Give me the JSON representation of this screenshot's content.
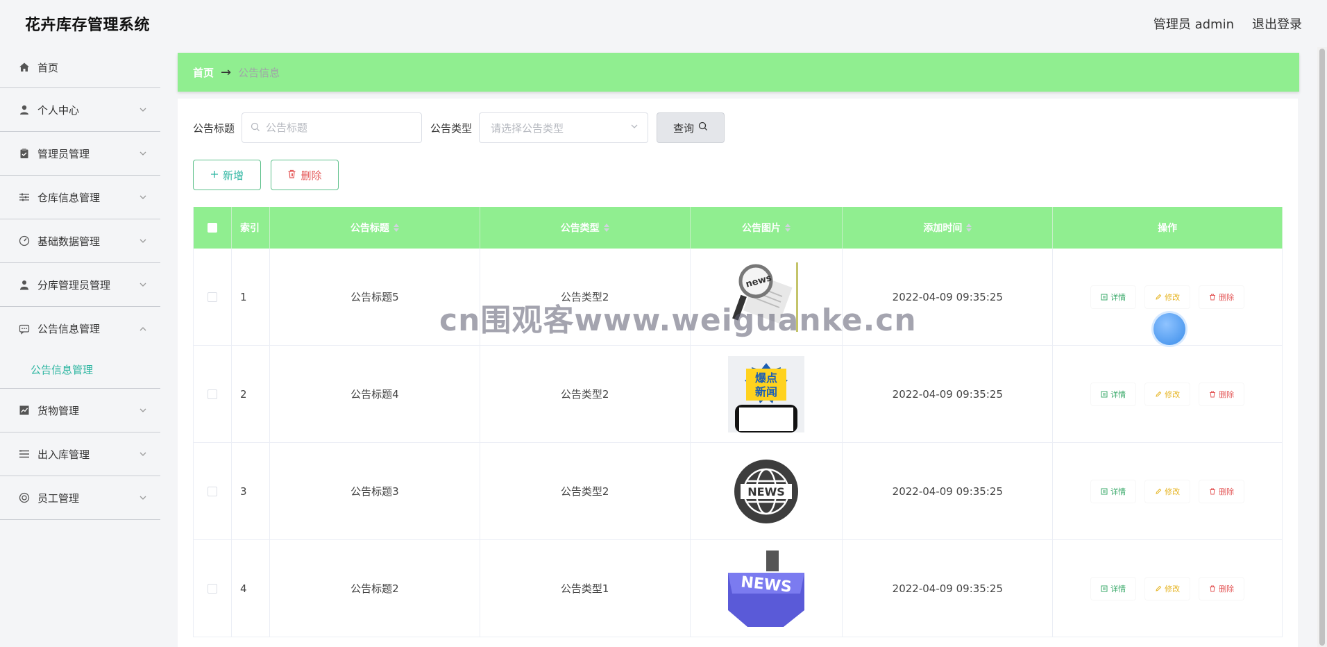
{
  "app": {
    "title": "花卉库存管理系统",
    "user_label": "管理员 admin",
    "logout_label": "退出登录"
  },
  "sidebar": {
    "items": [
      {
        "label": "首页",
        "icon": "home-icon"
      },
      {
        "label": "个人中心",
        "icon": "user-icon"
      },
      {
        "label": "管理员管理",
        "icon": "clipboard-icon"
      },
      {
        "label": "仓库信息管理",
        "icon": "sliders-icon"
      },
      {
        "label": "基础数据管理",
        "icon": "gauge-icon"
      },
      {
        "label": "分库管理员管理",
        "icon": "user-admin-icon"
      },
      {
        "label": "公告信息管理",
        "icon": "chat-icon",
        "open": true
      },
      {
        "label": "货物管理",
        "icon": "chart-icon"
      },
      {
        "label": "出入库管理",
        "icon": "list-icon"
      },
      {
        "label": "员工管理",
        "icon": "lifebuoy-icon"
      }
    ],
    "submenu_active": "公告信息管理"
  },
  "breadcrumb": {
    "home": "首页",
    "separator": "→",
    "current": "公告信息"
  },
  "search": {
    "title_label": "公告标题",
    "title_placeholder": "公告标题",
    "type_label": "公告类型",
    "type_placeholder": "请选择公告类型",
    "query_label": "查询"
  },
  "actions": {
    "add_label": "新增",
    "delete_label": "删除"
  },
  "table": {
    "headers": {
      "index": "索引",
      "title": "公告标题",
      "type": "公告类型",
      "image": "公告图片",
      "time": "添加时间",
      "ops": "操作"
    },
    "rows": [
      {
        "index": "1",
        "title": "公告标题5",
        "type": "公告类型2",
        "image": "news-magnifier",
        "time": "2022-04-09 09:35:25"
      },
      {
        "index": "2",
        "title": "公告标题4",
        "type": "公告类型2",
        "image": "breaking-news-phone",
        "time": "2022-04-09 09:35:25"
      },
      {
        "index": "3",
        "title": "公告标题3",
        "type": "公告类型2",
        "image": "news-globe",
        "time": "2022-04-09 09:35:25"
      },
      {
        "index": "4",
        "title": "公告标题2",
        "type": "公告类型1",
        "image": "news-key",
        "time": "2022-04-09 09:35:25"
      }
    ],
    "op_labels": {
      "detail": "详情",
      "edit": "修改",
      "remove": "删除"
    }
  },
  "overlay": {
    "watermark": "cn围观客www.weiguanke.cn"
  },
  "colors": {
    "header_green": "#90ee90",
    "accent_teal": "#2bb5a0",
    "danger": "#e45a5a",
    "warning": "#e6b422"
  }
}
